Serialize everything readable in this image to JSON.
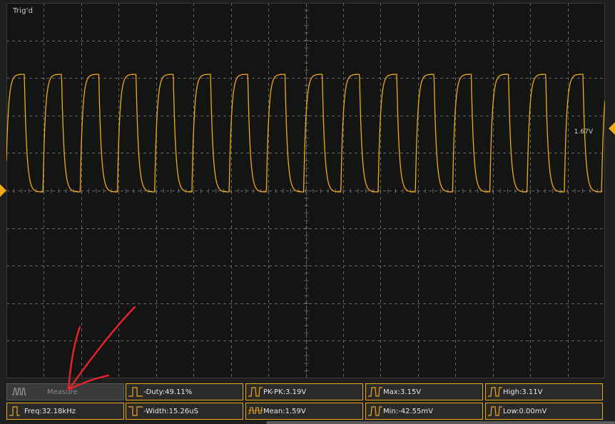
{
  "status": {
    "trigger_text": "Trig'd"
  },
  "channel": {
    "trigger_level_label": "1.67V",
    "color": "#f0a91a"
  },
  "measurements": {
    "button_label": "Measure",
    "items": [
      {
        "icon": "freq-icon",
        "text": "Freq:32.18kHz"
      },
      {
        "icon": "duty-icon",
        "text": "-Duty:49.11%"
      },
      {
        "icon": "neg-width-icon",
        "text": "-Width:15.26uS"
      },
      {
        "icon": "pkpk-icon",
        "text": "PK-PK:3.19V"
      },
      {
        "icon": "mean-icon",
        "text": "Mean:1.59V"
      },
      {
        "icon": "max-icon",
        "text": "Max:3.15V"
      },
      {
        "icon": "min-icon",
        "text": "Min:-42.55mV"
      },
      {
        "icon": "high-icon",
        "text": "High:3.11V"
      },
      {
        "icon": "low-icon",
        "text": "Low:0.00mV"
      }
    ]
  },
  "colors": {
    "trace": "#f0a91a",
    "grid": "#666666",
    "background": "#141414",
    "annotation": "#e8242a"
  }
}
